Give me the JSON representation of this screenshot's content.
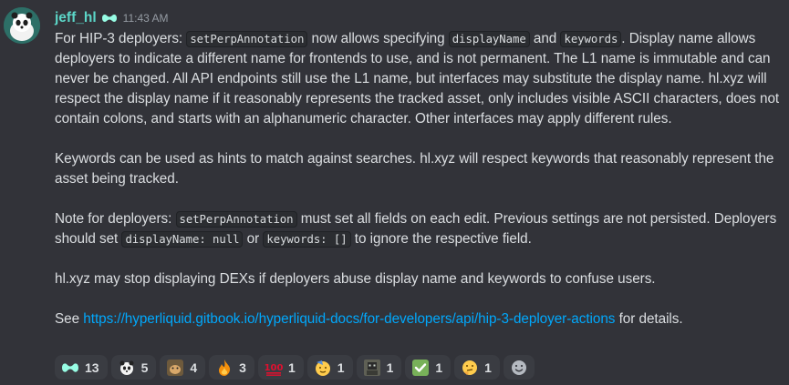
{
  "message": {
    "username": "jeff_hl",
    "timestamp": "11:43 AM",
    "paragraphs": {
      "p1": {
        "t1": "For HIP-3 deployers: ",
        "c1": "setPerpAnnotation",
        "t2": " now allows specifying ",
        "c2": "displayName",
        "t3": " and ",
        "c3": "keywords",
        "t4": ". Display name allows deployers to indicate a different name for frontends to use, and is not permanent. The L1 name is immutable and can never be changed. All API endpoints still use the L1 name, but interfaces may substitute the display name. hl.xyz will respect the display name if it reasonably represents the tracked asset, only includes visible ASCII characters, does not contain colons, and starts with an alphanumeric character. Other interfaces may apply different rules."
      },
      "p2": "Keywords can be used as hints to match against searches. hl.xyz will respect keywords that reasonably represent the asset being tracked.",
      "p3": {
        "t1": "Note for deployers: ",
        "c1": "setPerpAnnotation",
        "t2": " must set all fields on each edit. Previous settings are not persisted. Deployers should set ",
        "c2": "displayName: null",
        "t3": " or ",
        "c3": "keywords: []",
        "t4": " to ignore the respective field."
      },
      "p4": "hl.xyz may stop displaying DEXs if deployers abuse display name and keywords to confuse users.",
      "p5": {
        "t1": "See ",
        "link": "https://hyperliquid.gitbook.io/hyperliquid-docs/for-developers/api/hip-3-deployer-actions",
        "t2": " for details."
      }
    }
  },
  "reactions": [
    {
      "icon": "hyperliquid-logo-icon",
      "count": "13"
    },
    {
      "icon": "panda-icon",
      "count": "5"
    },
    {
      "icon": "hamster-icon",
      "count": "4"
    },
    {
      "icon": "fire-icon",
      "count": "3"
    },
    {
      "icon": "hundred-points-icon",
      "count": "1"
    },
    {
      "icon": "saluting-face-icon",
      "count": "1"
    },
    {
      "icon": "robot-character-icon",
      "count": "1"
    },
    {
      "icon": "check-mark-icon",
      "count": "1"
    },
    {
      "icon": "thinking-face-icon",
      "count": "1"
    }
  ],
  "colors": {
    "background": "#323339",
    "username": "#5cd6c8",
    "link": "#00a8fc",
    "text": "#dbdee1",
    "timestamp": "#959ba3"
  }
}
